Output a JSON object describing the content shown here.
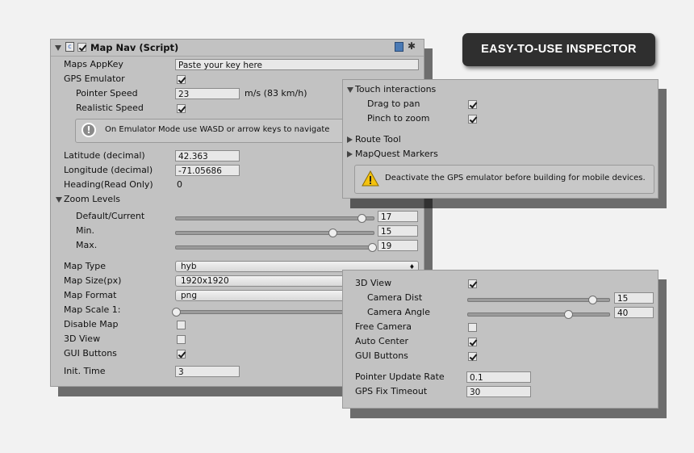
{
  "badge": {
    "label": "EASY-TO-USE INSPECTOR"
  },
  "main": {
    "title": "Map Nav (Script)",
    "appkey": {
      "label": "Maps AppKey",
      "value": "Paste your key here"
    },
    "gps_emulator": {
      "label": "GPS Emulator",
      "checked": true
    },
    "pointer_speed": {
      "label": "Pointer Speed",
      "value": "23",
      "unit": "m/s (83 km/h)"
    },
    "realistic_speed": {
      "label": "Realistic Speed",
      "checked": true
    },
    "info": "On Emulator Mode use WASD or arrow keys to navigate",
    "latitude": {
      "label": "Latitude (decimal)",
      "value": "42.363"
    },
    "longitude": {
      "label": "Longitude (decimal)",
      "value": "-71.05686"
    },
    "heading": {
      "label": "Heading(Read Only)",
      "value": "0"
    },
    "zoom": {
      "label": "Zoom Levels",
      "default": {
        "label": "Default/Current",
        "value": "17",
        "fraction": 0.94
      },
      "min": {
        "label": "Min.",
        "value": "15",
        "fraction": 0.79
      },
      "max": {
        "label": "Max.",
        "value": "19",
        "fraction": 0.99
      }
    },
    "map_type": {
      "label": "Map Type",
      "value": "hyb"
    },
    "map_size": {
      "label": "Map Size(px)",
      "value": "1920x1920"
    },
    "map_format": {
      "label": "Map Format",
      "value": "png"
    },
    "map_scale": {
      "label": "Map Scale 1:",
      "fraction": 0.0
    },
    "disable_map": {
      "label": "Disable Map",
      "checked": false
    },
    "view3d": {
      "label": "3D View",
      "checked": false
    },
    "gui_buttons": {
      "label": "GUI Buttons",
      "checked": true
    },
    "init_time": {
      "label": "Init. Time",
      "value": "3"
    }
  },
  "touch": {
    "title": "Touch interactions",
    "drag": {
      "label": "Drag to pan",
      "checked": true
    },
    "pinch": {
      "label": "Pinch to zoom",
      "checked": true
    },
    "route_tool": "Route Tool",
    "mapquest": "MapQuest Markers",
    "warning": "Deactivate the GPS emulator before building for mobile devices."
  },
  "view3d": {
    "view3d": {
      "label": "3D View",
      "checked": true
    },
    "camera_dist": {
      "label": "Camera Dist",
      "value": "15",
      "fraction": 0.88
    },
    "camera_angle": {
      "label": "Camera Angle",
      "value": "40",
      "fraction": 0.71
    },
    "free_camera": {
      "label": "Free Camera",
      "checked": false
    },
    "auto_center": {
      "label": "Auto Center",
      "checked": true
    },
    "gui_buttons": {
      "label": "GUI Buttons",
      "checked": true
    },
    "pointer_rate": {
      "label": "Pointer Update Rate",
      "value": "0.1"
    },
    "gps_fix": {
      "label": "GPS Fix Timeout",
      "value": "30"
    }
  },
  "colors": {
    "panel_bg": "#c2c2c2",
    "badge_bg": "#2f2f2f",
    "warning": "#f4c20d"
  }
}
